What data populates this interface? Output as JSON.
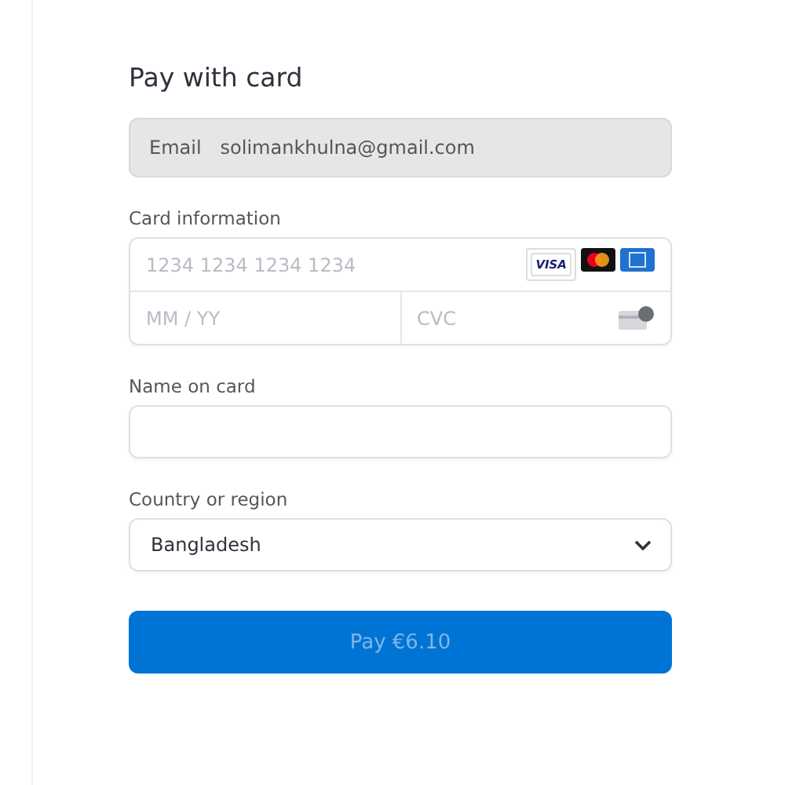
{
  "title": "Pay with card",
  "email": {
    "label": "Email",
    "value": "solimankhulna@gmail.com"
  },
  "card_information": {
    "label": "Card information",
    "number": {
      "placeholder": "1234 1234 1234 1234"
    },
    "brands": [
      {
        "kind": "visa",
        "label": "VISA"
      },
      {
        "kind": "mastercard"
      },
      {
        "kind": "amex"
      }
    ],
    "expiry": {
      "placeholder": "MM / YY"
    },
    "cvc": {
      "placeholder": "CVC"
    }
  },
  "name_on_card": {
    "label": "Name on card"
  },
  "country": {
    "label": "Country or region",
    "value": "Bangladesh"
  },
  "pay_button": {
    "label": "Pay €6.10",
    "disabled": true
  }
}
